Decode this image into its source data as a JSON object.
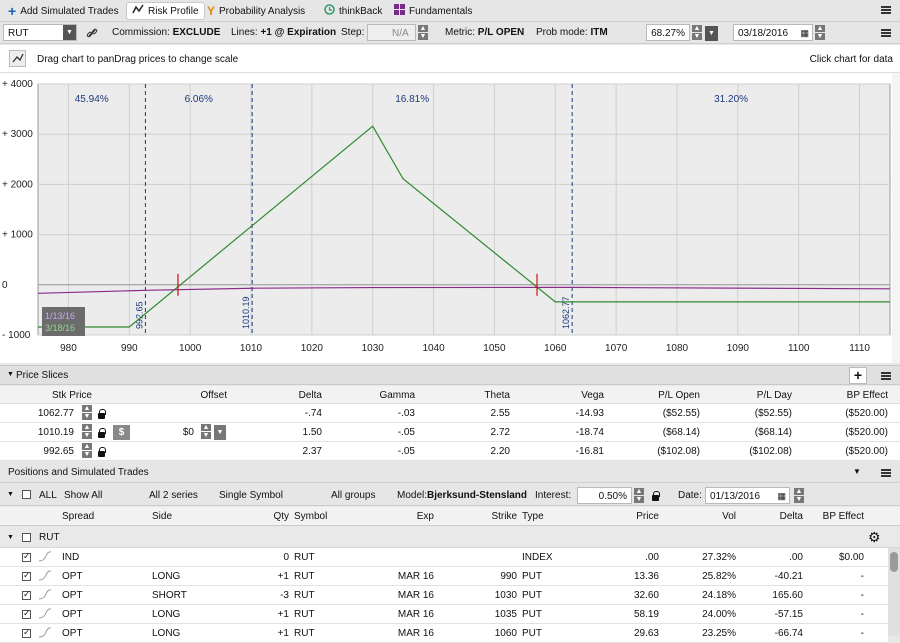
{
  "tabs": [
    {
      "label": "Add Simulated Trades",
      "icon": "plus-icon"
    },
    {
      "label": "Risk Profile",
      "icon": "risk-profile-icon"
    },
    {
      "label": "Probability Analysis",
      "icon": "probability-icon"
    },
    {
      "label": "thinkBack",
      "icon": "thinkback-icon"
    },
    {
      "label": "Fundamentals",
      "icon": "fundamentals-icon"
    }
  ],
  "toolbar": {
    "symbol": "RUT",
    "commission_label": "Commission:",
    "commission_value": "EXCLUDE",
    "lines_label": "Lines:",
    "lines_value": "+1 @ Expiration",
    "step_label": "Step:",
    "step_value": "N/A",
    "metric_label": "Metric:",
    "metric_value": "P/L OPEN",
    "prob_label": "Prob mode:",
    "prob_value": "ITM",
    "percent_value": "68.27%",
    "date_value": "03/18/2016"
  },
  "hint": {
    "left": "Drag chart to panDrag prices to change scale",
    "right": "Click chart for data"
  },
  "chart_data": {
    "type": "line",
    "x_ticks": [
      "980",
      "990",
      "1000",
      "1010",
      "1020",
      "1030",
      "1040",
      "1050",
      "1060",
      "1070",
      "1080",
      "1090",
      "1100",
      "1110"
    ],
    "y_ticks": [
      "+ 4000",
      "+ 3000",
      "+ 2000",
      "+ 1000",
      "0",
      "- 1000"
    ],
    "xlim": [
      975,
      1115
    ],
    "ylim": [
      -1000,
      4000
    ],
    "series": [
      {
        "role": "expiration-pl",
        "color": "#2f8a2f",
        "x": [
          975,
          990,
          1030,
          1035,
          1060,
          1062.77,
          1115
        ],
        "y": [
          -840,
          -840,
          3160,
          2110,
          -340,
          -340,
          -340
        ]
      },
      {
        "role": "day-pl",
        "color": "#8b2a8b",
        "x": [
          975,
          992.65,
          1010.19,
          1030,
          1062.77,
          1115
        ],
        "y": [
          -170,
          -110,
          -68,
          -55,
          -52,
          -80
        ]
      }
    ],
    "prob_labels": [
      "45.94%",
      "6.06%",
      "16.81%",
      "31.20%"
    ],
    "slice_lines": [
      {
        "x": 992.65,
        "label": "992.65"
      },
      {
        "x": 1010.19,
        "label": "1010.19"
      },
      {
        "x": 1062.77,
        "label": "1062.77"
      }
    ],
    "breakevens": [
      998,
      1057
    ],
    "date_labels": [
      "1/13/16",
      "3/18/16"
    ]
  },
  "price_slices": {
    "title": "Price Slices",
    "headers": [
      "Stk Price",
      "Offset",
      "Delta",
      "Gamma",
      "Theta",
      "Vega",
      "P/L Open",
      "P/L Day",
      "BP Effect"
    ],
    "rows": [
      {
        "price": "1062.77",
        "offset": "",
        "delta": "-.74",
        "gamma": "-.03",
        "theta": "2.55",
        "vega": "-14.93",
        "pl_open": "($52.55)",
        "pl_day": "($52.55)",
        "bp": "($520.00)"
      },
      {
        "price": "1010.19",
        "offset": "$0",
        "delta": "1.50",
        "gamma": "-.05",
        "theta": "2.72",
        "vega": "-18.74",
        "pl_open": "($68.14)",
        "pl_day": "($68.14)",
        "bp": "($520.00)"
      },
      {
        "price": "992.65",
        "offset": "",
        "delta": "2.37",
        "gamma": "-.05",
        "theta": "2.20",
        "vega": "-16.81",
        "pl_open": "($102.08)",
        "pl_day": "($102.08)",
        "bp": "($520.00)"
      }
    ]
  },
  "positions": {
    "title": "Positions and Simulated Trades",
    "filters": {
      "all": "ALL",
      "show": "Show All",
      "series": "All 2 series",
      "symbol": "Single Symbol",
      "groups": "All groups",
      "model_label": "Model:",
      "model": "Bjerksund-Stensland",
      "interest_label": "Interest:",
      "interest": "0.50%",
      "date_label": "Date:",
      "date": "01/13/2016"
    },
    "headers": [
      "Spread",
      "Side",
      "Qty",
      "Symbol",
      "Exp",
      "Strike",
      "Type",
      "Price",
      "Vol",
      "Delta",
      "BP Effect"
    ],
    "group": "RUT",
    "rows": [
      {
        "spread": "IND",
        "side": "",
        "qty": "0",
        "symbol": "RUT",
        "exp": "",
        "strike": "",
        "type": "INDEX",
        "price": ".00",
        "vol": "27.32%",
        "delta": ".00",
        "bp": "$0.00"
      },
      {
        "spread": "OPT",
        "side": "LONG",
        "qty": "+1",
        "symbol": "RUT",
        "exp": "MAR 16",
        "strike": "990",
        "type": "PUT",
        "price": "13.36",
        "vol": "25.82%",
        "delta": "-40.21",
        "bp": "-"
      },
      {
        "spread": "OPT",
        "side": "SHORT",
        "qty": "-3",
        "symbol": "RUT",
        "exp": "MAR 16",
        "strike": "1030",
        "type": "PUT",
        "price": "32.60",
        "vol": "24.18%",
        "delta": "165.60",
        "bp": "-"
      },
      {
        "spread": "OPT",
        "side": "LONG",
        "qty": "+1",
        "symbol": "RUT",
        "exp": "MAR 16",
        "strike": "1035",
        "type": "PUT",
        "price": "58.19",
        "vol": "24.00%",
        "delta": "-57.15",
        "bp": "-"
      },
      {
        "spread": "OPT",
        "side": "LONG",
        "qty": "+1",
        "symbol": "RUT",
        "exp": "MAR 16",
        "strike": "1060",
        "type": "PUT",
        "price": "29.63",
        "vol": "23.25%",
        "delta": "-66.74",
        "bp": "-"
      }
    ]
  }
}
